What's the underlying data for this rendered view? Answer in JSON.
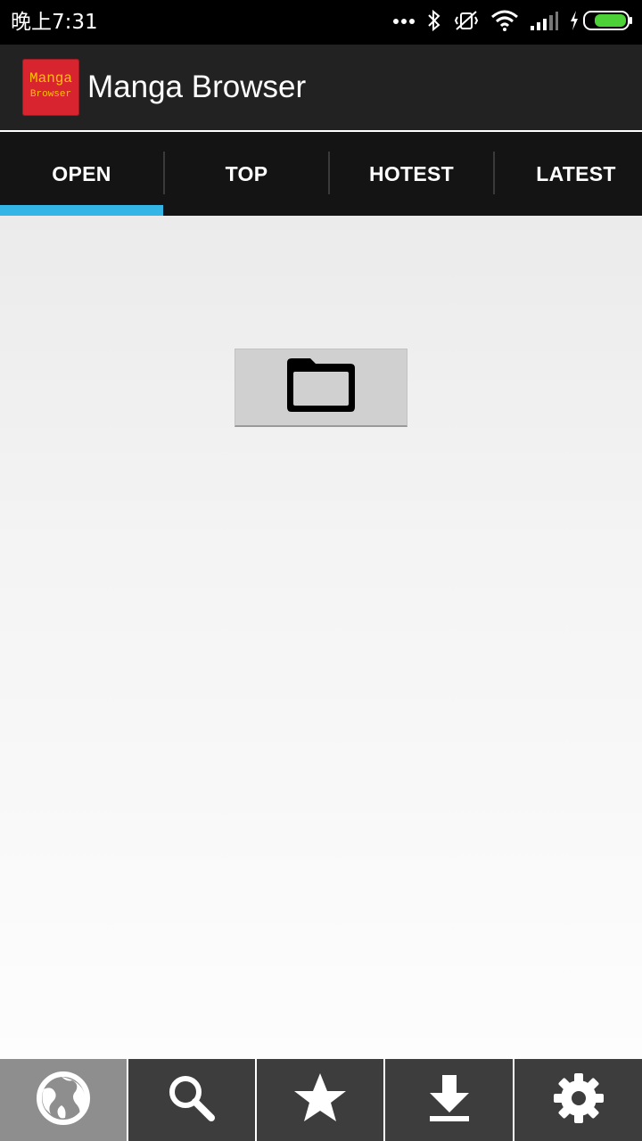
{
  "status_bar": {
    "time": "晚上7:31",
    "icons": [
      "more-dots-icon",
      "bluetooth-icon",
      "vibrate-off-icon",
      "wifi-icon",
      "signal-icon",
      "charging-icon",
      "battery-icon"
    ]
  },
  "action_bar": {
    "logo_line1": "Manga",
    "logo_line2": "Browser",
    "title": "Manga Browser"
  },
  "tabs": [
    {
      "label": "OPEN",
      "selected": true
    },
    {
      "label": "TOP",
      "selected": false
    },
    {
      "label": "HOTEST",
      "selected": false
    },
    {
      "label": "LATEST",
      "selected": false
    }
  ],
  "content": {
    "open_button_icon": "folder-icon"
  },
  "bottom_nav": [
    {
      "icon": "globe-icon",
      "active": true
    },
    {
      "icon": "search-icon",
      "active": false
    },
    {
      "icon": "star-icon",
      "active": false
    },
    {
      "icon": "download-icon",
      "active": false
    },
    {
      "icon": "gear-icon",
      "active": false
    }
  ],
  "colors": {
    "tab_indicator": "#33b5e5",
    "action_bar": "#222222",
    "tab_bar": "#141414",
    "logo_background": "#d8242f",
    "logo_text": "#ffc100",
    "battery_fill": "#4cd137"
  }
}
